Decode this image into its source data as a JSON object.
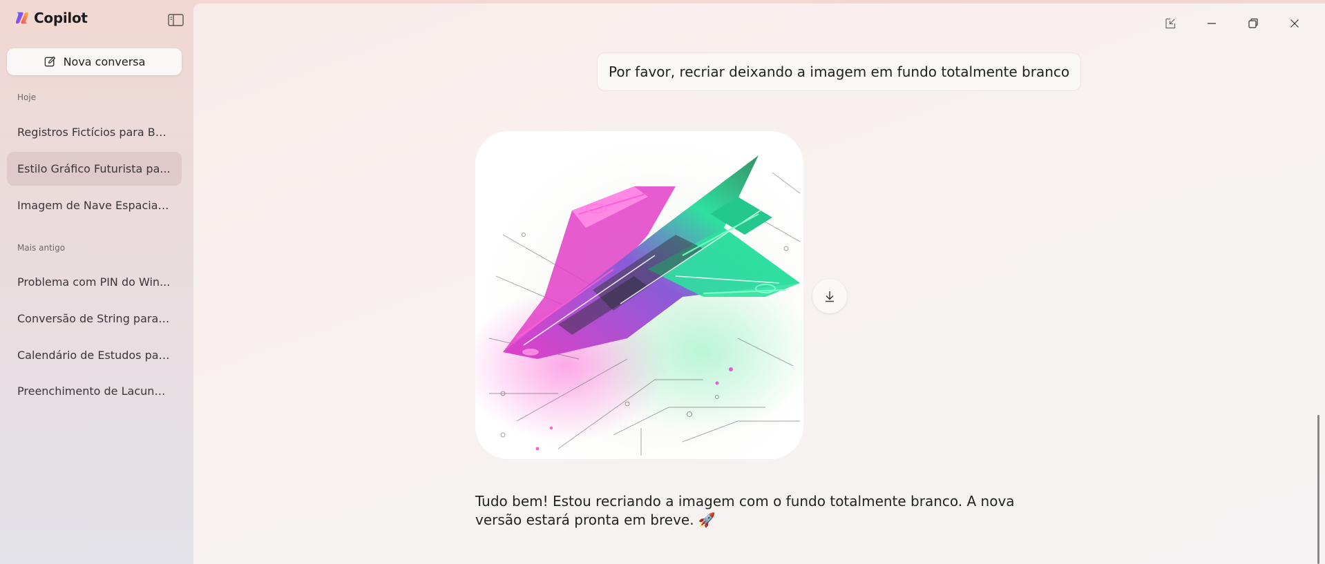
{
  "brand": {
    "name": "Copilot"
  },
  "sidebar": {
    "new_chat_label": "Nova conversa",
    "sections": [
      {
        "title": "Hoje",
        "items": [
          {
            "label": "Registros Fictícios para Ba..."
          },
          {
            "label": "Estilo Gráfico Futurista pa..."
          },
          {
            "label": "Imagem de Nave Espacial..."
          }
        ]
      },
      {
        "title": "Mais antigo",
        "items": [
          {
            "label": "Problema com PIN do Win..."
          },
          {
            "label": "Conversão de String para I..."
          },
          {
            "label": "Calendário de Estudos par..."
          },
          {
            "label": "Preenchimento de Lacuna..."
          }
        ]
      }
    ]
  },
  "conversation": {
    "user_message": "Por favor, recriar deixando a imagem em fundo totalmente branco",
    "image_alt": "spaceship-image",
    "assistant_message": "Tudo bem! Estou recriando a imagem com o fundo totalmente branco. A nova versão estará pronta em breve. 🚀"
  },
  "colors": {
    "accent_pink": "#e23fc8",
    "accent_green": "#2fe0a0",
    "active_item_bg": "#dfc9cb"
  }
}
